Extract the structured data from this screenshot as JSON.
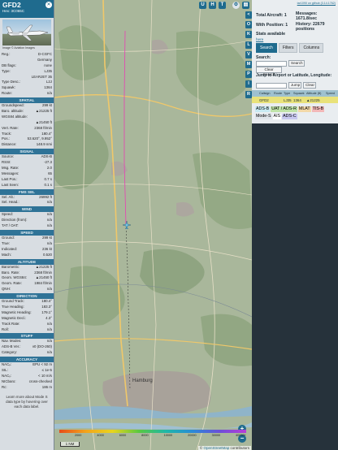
{
  "aircraft": {
    "callsign": "GFD2",
    "hex_line": "Hex: 3C065C",
    "photo_credit": "Image © Aviation Images",
    "close_icon": "close-icon"
  },
  "basic": [
    {
      "label": "Reg.:",
      "value": "D-CGFC"
    },
    {
      "label": "",
      "value": "Germany"
    },
    {
      "label": "DB flags:",
      "value": "none"
    },
    {
      "label": "Type:",
      "value": "LJ35"
    },
    {
      "label": "",
      "value": "LEARJET 35"
    },
    {
      "label": "Type Desc.:",
      "value": "L2J"
    },
    {
      "label": "Squawk:",
      "value": "1364"
    },
    {
      "label": "Route:",
      "value": "n/a"
    }
  ],
  "sections": [
    {
      "title": "SPATIAL",
      "rows": [
        {
          "label": "Groundspeed:",
          "value": "299 kt"
        },
        {
          "label": "Baro. altitude:",
          "value": "▲21225 ft"
        },
        {
          "label": "WGS84 altitude:",
          "value": ""
        },
        {
          "label": "",
          "value": "▲21450 ft"
        },
        {
          "label": "Vert. Rate:",
          "value": "2368 ft/min"
        },
        {
          "label": "Track:",
          "value": "180.4°"
        },
        {
          "label": "Pos.:",
          "value": "53.620°, 9.952°"
        },
        {
          "label": "Distance:",
          "value": "148.9 nmi"
        }
      ]
    },
    {
      "title": "SIGNAL",
      "rows": [
        {
          "label": "Source:",
          "value": "ADS-B"
        },
        {
          "label": "RSSI:",
          "value": "-27.3"
        },
        {
          "label": "Msg. Rate:",
          "value": "2.0"
        },
        {
          "label": "Messages:",
          "value": "65"
        },
        {
          "label": "Last Pos.:",
          "value": "0.7 s"
        },
        {
          "label": "Last Seen:",
          "value": "0.1 s"
        }
      ]
    },
    {
      "title": "FMS SEL",
      "rows": [
        {
          "label": "Sel. Alt.:",
          "value": "26992 ft"
        },
        {
          "label": "Sel. Head.:",
          "value": "n/a"
        }
      ]
    },
    {
      "title": "WIND",
      "rows": [
        {
          "label": "Speed:",
          "value": "n/a"
        },
        {
          "label": "Direction (from):",
          "value": "n/a"
        },
        {
          "label": "TAT / OAT:",
          "value": "n/a"
        }
      ]
    },
    {
      "title": "SPEED",
      "rows": [
        {
          "label": "Ground:",
          "value": "299 kt"
        },
        {
          "label": "True:",
          "value": "n/a"
        },
        {
          "label": "Indicated:",
          "value": "236 kt"
        },
        {
          "label": "Mach:",
          "value": "0.520"
        }
      ]
    },
    {
      "title": "ALTITUDE",
      "rows": [
        {
          "label": "Barometric:",
          "value": "▲21225 ft"
        },
        {
          "label": "Baro. Rate:",
          "value": "2368 ft/min"
        },
        {
          "label": "Geom. WGS84:",
          "value": "▲21450 ft"
        },
        {
          "label": "Geom. Rate:",
          "value": "1984 ft/min"
        },
        {
          "label": "QNH:",
          "value": "n/a"
        }
      ]
    },
    {
      "title": "DIRECTION",
      "rows": [
        {
          "label": "Ground Track:",
          "value": "180.4°"
        },
        {
          "label": "True Heading:",
          "value": "183.3°"
        },
        {
          "label": "Magnetic Heading:",
          "value": "179.1°"
        },
        {
          "label": "Magnetic Decl.:",
          "value": "4.3°"
        },
        {
          "label": "Track Rate:",
          "value": "n/a"
        },
        {
          "label": "Roll:",
          "value": "n/a"
        }
      ]
    },
    {
      "title": "STUFF",
      "rows": [
        {
          "label": "Nav. Modes:",
          "value": "n/a"
        },
        {
          "label": "ADS-B Ver.:",
          "value": "v0 (DO-260)"
        },
        {
          "label": "Category:",
          "value": "n/a"
        }
      ]
    },
    {
      "title": "ACCURACY",
      "rows": [
        {
          "label": "NACₚ:",
          "value": "EPU < 92 m"
        },
        {
          "label": "SIL:",
          "value": "≤ 1e-5"
        },
        {
          "label": "NACᵥ:",
          "value": "< 10 m/s"
        },
        {
          "label": "NICbaro:",
          "value": "cross-checked"
        },
        {
          "label": "Rc:",
          "value": "186 m"
        }
      ]
    }
  ],
  "footer_text": "Learn more about Mode S data type by hovering over each data label.",
  "map": {
    "top_buttons": [
      "U",
      "H",
      "T"
    ],
    "settings_icon": "gear-icon",
    "layers_icon": "layers-icon",
    "side_buttons": [
      "<",
      "O",
      "K",
      "L",
      "V",
      "M",
      "P",
      "I",
      "R"
    ],
    "zoom_in": "+",
    "zoom_out": "−",
    "scale_label": "1 NM",
    "attribution_prefix": "©",
    "attribution_link": "OpenStreetMap",
    "attribution_suffix": "contributors",
    "altitude_ticks": [
      "",
      "2000",
      "4000",
      "6000",
      "8000",
      "10000",
      "20000",
      "30000",
      "40000+"
    ]
  },
  "right": {
    "version_link": "tar1090 on github (3.14.1762)",
    "total_label": "Total Aircraft: 1",
    "with_pos_label": "With Position: 1",
    "stats_label": "Stats available",
    "stats_link": "here",
    "messages_label": "Messages:",
    "messages_value": "1671.8/sec",
    "history_label": "History: 22679",
    "history_value": "positions",
    "tabs": [
      "Search",
      "Filters",
      "Columns"
    ],
    "search_label": "Search:",
    "search_button": "Search",
    "clear_search_button": "Clear Search",
    "jump_label": "Jump to Airport or Latitude, Longitude:",
    "jump_button": "Jump",
    "clear_button": "Clear",
    "columns": [
      "",
      "Callsign",
      "Route",
      "Type",
      "Squawk",
      "Altitude (ft)",
      "Speed"
    ],
    "row": [
      "",
      "GFD2",
      "",
      "LJ35",
      "1364",
      "▲21225",
      ""
    ],
    "legend": [
      {
        "label": "ADS-B",
        "color": "#c7e9f2"
      },
      {
        "label": "UAT / ADS-R",
        "color": "#bfe3a8"
      },
      {
        "label": "MLAT",
        "color": "#f2d8a8"
      },
      {
        "label": "TIS-B",
        "color": "#f2b8b8"
      },
      {
        "label": "Mode-S",
        "color": "#dfe4ea"
      },
      {
        "label": "AIS",
        "color": "#ffffff"
      },
      {
        "label": "ADS-C",
        "color": "#c8c8f0"
      }
    ]
  }
}
